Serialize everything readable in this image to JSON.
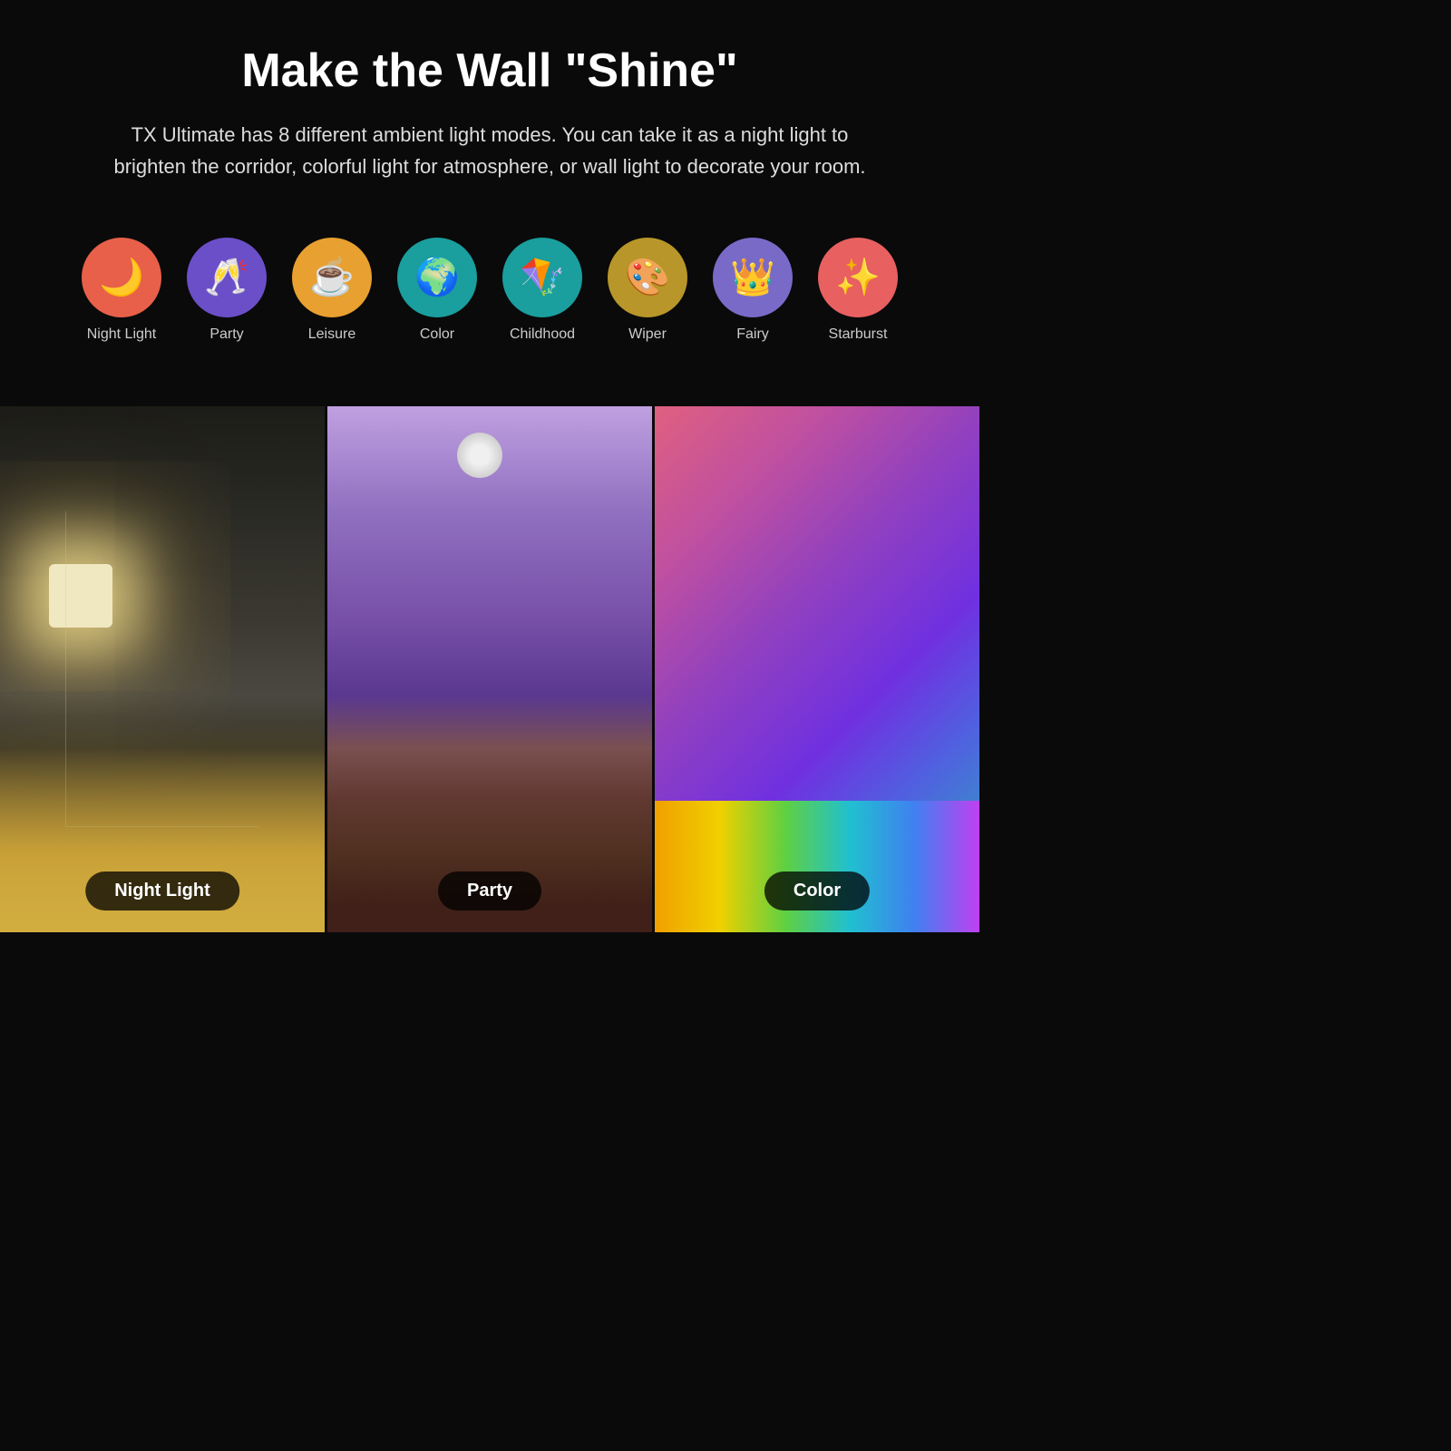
{
  "header": {
    "title": "Make the Wall \"Shine\"",
    "subtitle": "TX Ultimate has 8 different ambient light modes. You can take it as a night light to brighten the corridor, colorful light for atmosphere, or wall light to decorate your room."
  },
  "modes": [
    {
      "id": "night-light",
      "label": "Night Light",
      "bg": "#e8604a",
      "emoji": "🌙"
    },
    {
      "id": "party",
      "label": "Party",
      "bg": "#6b4fc8",
      "emoji": "🥂"
    },
    {
      "id": "leisure",
      "label": "Leisure",
      "bg": "#e8a030",
      "emoji": "☕"
    },
    {
      "id": "color",
      "label": "Color",
      "bg": "#1a9e9e",
      "emoji": "🌍"
    },
    {
      "id": "childhood",
      "label": "Childhood",
      "bg": "#1a9e9e",
      "emoji": "🪁"
    },
    {
      "id": "wiper",
      "label": "Wiper",
      "bg": "#b8962a",
      "emoji": "🎨"
    },
    {
      "id": "fairy",
      "label": "Fairy",
      "bg": "#7a6ac8",
      "emoji": "👑"
    },
    {
      "id": "starburst",
      "label": "Starburst",
      "bg": "#e86060",
      "emoji": "✨"
    }
  ],
  "photos": [
    {
      "id": "night-light-photo",
      "label": "Night Light"
    },
    {
      "id": "party-photo",
      "label": "Party"
    },
    {
      "id": "color-photo",
      "label": "Color"
    }
  ]
}
